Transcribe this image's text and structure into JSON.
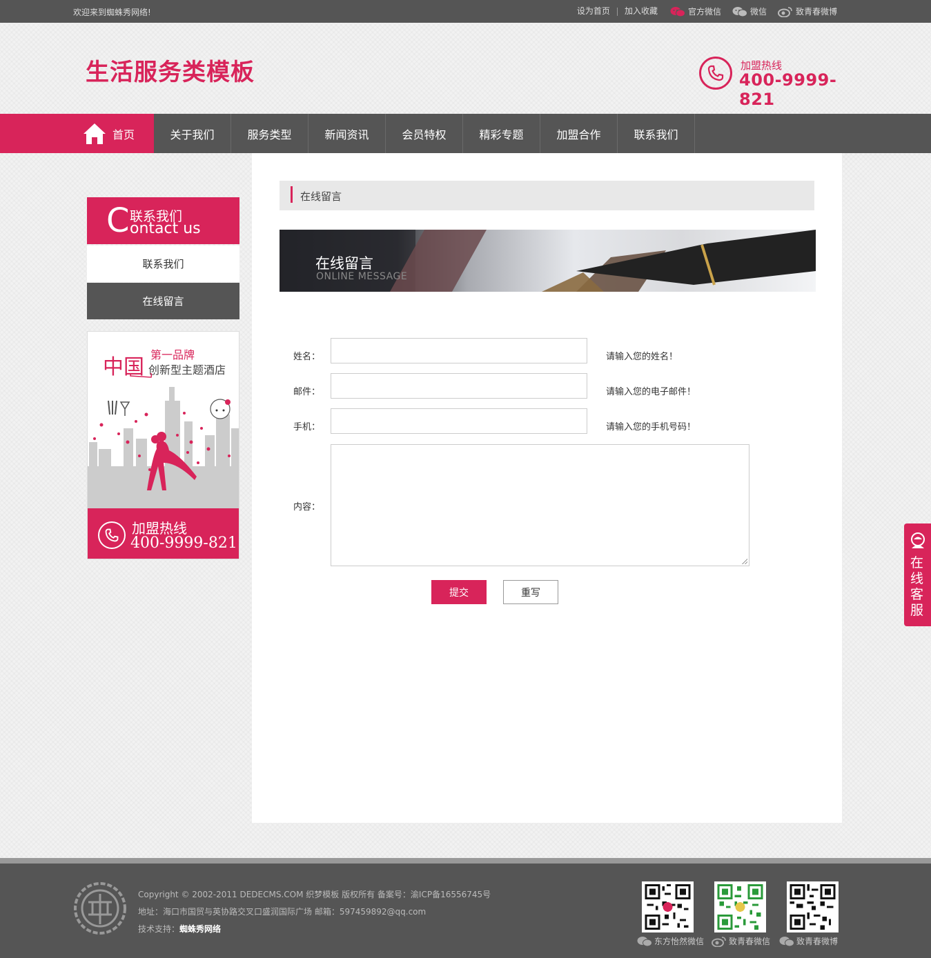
{
  "topbar": {
    "welcome": "欢迎来到蜘蛛秀网络!",
    "set_home": "设为首页",
    "favorite": "加入收藏",
    "official_wechat": "官方微信",
    "wechat": "微信",
    "weibo": "致青春微博"
  },
  "header": {
    "logo": "生活服务类模板",
    "hotline_label": "加盟热线",
    "hotline_number": "400-9999-821"
  },
  "nav": {
    "items": [
      "首页",
      "关于我们",
      "服务类型",
      "新闻资讯",
      "会员特权",
      "精彩专题",
      "加盟合作",
      "联系我们"
    ]
  },
  "sidebar": {
    "title_letter": "C",
    "title_cn": "联系我们",
    "title_en": "ontact us",
    "items": [
      "联系我们",
      "在线留言"
    ],
    "promo": {
      "china": "中国",
      "brand": "第一品牌",
      "hotel": "创新型主题酒店",
      "hotline_label": "加盟热线",
      "hotline_number": "400-9999-821"
    }
  },
  "content": {
    "breadcrumb": "在线留言",
    "banner_title": "在线留言",
    "banner_sub": "ONLINE MESSAGE",
    "form": {
      "name_label": "姓名：",
      "name_tip": "请输入您的姓名！",
      "email_label": "邮件：",
      "email_tip": "请输入您的电子邮件！",
      "phone_label": "手机：",
      "phone_tip": "请输入您的手机号码！",
      "content_label": "内容：",
      "submit": "提交",
      "reset": "重写"
    }
  },
  "kefu": {
    "label": "在线客服"
  },
  "footer": {
    "copyright": "Copyright © 2002-2011 DEDECMS.COM 织梦模板 版权所有 备案号：渝ICP备16556745号",
    "address": "地址：海口市国贸与英协路交叉口盛润国际广场 邮箱：597459892@qq.com",
    "support_label": "技术支持：",
    "support_name": "蜘蛛秀网络",
    "qr_captions": [
      "东方怡然微信",
      "致青春微信",
      "致青春微博"
    ]
  },
  "colors": {
    "accent": "#d8245a",
    "dark": "#555555"
  }
}
